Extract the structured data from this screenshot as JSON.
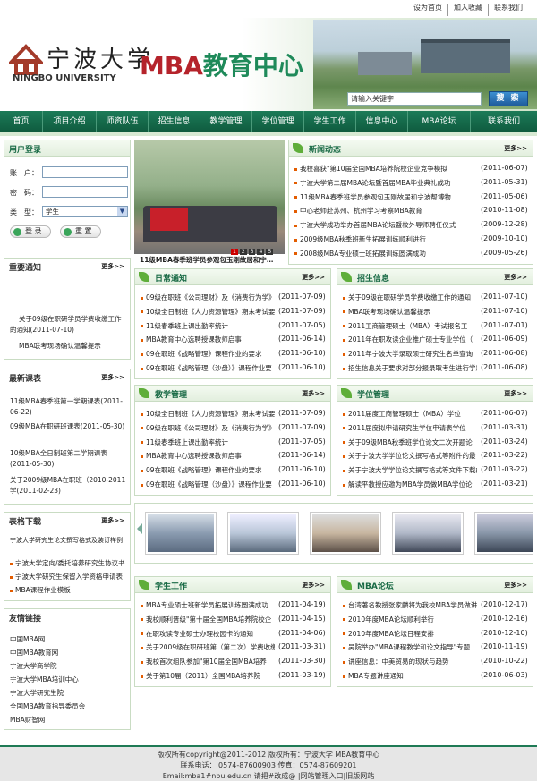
{
  "top_links": [
    "设为首页",
    "加入收藏",
    "联系我们"
  ],
  "header": {
    "school_cn": "宁波大学",
    "school_en": "NINGBO UNIVERSITY",
    "center_prefix": "MBA",
    "center_cn": "教育中心",
    "search_placeholder": "请输入关键字",
    "search_btn": "搜 索"
  },
  "nav": [
    "首页",
    "项目介绍",
    "师资队伍",
    "招生信息",
    "教学管理",
    "学位管理",
    "学生工作",
    "信息中心",
    "MBA论坛",
    "联系我们"
  ],
  "login": {
    "title": "用户登录",
    "account_label": "账　户：",
    "password_label": "密　码：",
    "type_label": "类　型：",
    "type_value": "学生",
    "login_btn": "登 录",
    "reset_btn": "重 置"
  },
  "photo_caption": "11级MBA春季班学员参观包玉刚故居和宁…",
  "photo_pager": [
    "1",
    "2",
    "3",
    "4",
    "5"
  ],
  "more": "更多>>",
  "important": {
    "title": "重要通知",
    "items": [
      "关于09级在职研学员学费收缴工作的通知(2011-07-10)",
      "MBA联考现场确认温馨提示"
    ]
  },
  "courses": {
    "title": "最新课表",
    "items": [
      "11级MBA春季班第一学期课表(2011-06-22)",
      "09级MBA在职研班课表(2011-05-30)",
      "10级MBA全日制班第二学期课表(2011-05-30)",
      "关于2009级MBA在职班（2010-2011学(2011-02-23)"
    ]
  },
  "forms": {
    "title": "表格下载",
    "items": [
      "宁波大学研究生论文撰写格式及装订样例",
      "宁波大学定向/委托培养研究生协议书",
      "宁波大学研究生保留入学资格申请表",
      "MBA课程作业模板"
    ]
  },
  "friends": {
    "title": "友情链接",
    "items": [
      "中国MBA网",
      "中国MBA教育网",
      "宁波大学商学院",
      "宁波大学MBA培训中心",
      "宁波大学研究生院",
      "全国MBA教育指导委员会",
      "MBA财智网"
    ]
  },
  "news": {
    "title": "新闻动态",
    "items": [
      {
        "t": "我校喜获\"第10届全国MBA培养院校企业竞争模拟",
        "d": "(2011-06-07)"
      },
      {
        "t": "宁波大学第二届MBA论坛暨首届MBA毕业典礼成功",
        "d": "(2011-05-31)"
      },
      {
        "t": "11级MBA春季班学员参观包玉刚故居和宁波帮博物",
        "d": "(2011-05-06)"
      },
      {
        "t": "中心老师赴苏州、杭州学习考察MBA教育",
        "d": "(2010-11-08)"
      },
      {
        "t": "宁波大学成功举办首届MBA论坛暨校外导师聘任仪式",
        "d": "(2009-12-28)"
      },
      {
        "t": "2009级MBA秋季班新生拓展训练顺利进行",
        "d": "(2009-10-10)"
      },
      {
        "t": "2008级MBA专业硕士班拓展训练圆满成功",
        "d": "(2009-05-26)"
      }
    ]
  },
  "daily": {
    "title": "日常通知",
    "items": [
      {
        "t": "09级在职班《公司理财》及《消费行为学》",
        "d": "(2011-07-09)"
      },
      {
        "t": "10级全日制班《人力资源管理》期末考试要",
        "d": "(2011-07-09)"
      },
      {
        "t": "11级春季班上课出勤率统计",
        "d": "(2011-07-05)"
      },
      {
        "t": "MBA教育中心选聘授课教师启事",
        "d": "(2011-06-14)"
      },
      {
        "t": "09在职班《战略管理》课程作业的要求",
        "d": "(2011-06-10)"
      },
      {
        "t": "09在职班《战略管理（沙盘）》课程作业要",
        "d": "(2011-06-10)"
      }
    ]
  },
  "enroll": {
    "title": "招生信息",
    "items": [
      {
        "t": "关于09级在职研学员学费收缴工作的通知",
        "d": "(2011-07-10)"
      },
      {
        "t": "MBA联考现场确认温馨提示",
        "d": "(2011-07-10)"
      },
      {
        "t": "2011工商管理硕士（MBA）考试报名工",
        "d": "(2011-07-01)"
      },
      {
        "t": "2011年在职攻读企业推广硕士专业学位（",
        "d": "(2011-06-09)"
      },
      {
        "t": "2011年宁波大学录取硕士研究生名单查询",
        "d": "(2011-06-08)"
      },
      {
        "t": "招生信息关于要求对部分报录取考生进行学籍",
        "d": "(2011-06-08)"
      }
    ]
  },
  "teaching": {
    "title": "教学管理",
    "items": [
      {
        "t": "10级全日制班《人力资源管理》期末考试要",
        "d": "(2011-07-09)"
      },
      {
        "t": "09级在职班《公司理财》及《消费行为学》",
        "d": "(2011-07-09)"
      },
      {
        "t": "11级春季班上课出勤率统计",
        "d": "(2011-07-05)"
      },
      {
        "t": "MBA教育中心选聘授课教师启事",
        "d": "(2011-06-14)"
      },
      {
        "t": "09在职班《战略管理》课程作业的要求",
        "d": "(2011-06-10)"
      },
      {
        "t": "09在职班《战略管理（沙盘）》课程作业要",
        "d": "(2011-06-10)"
      }
    ]
  },
  "degree": {
    "title": "学位管理",
    "items": [
      {
        "t": "2011届度工商管理硕士（MBA）学位",
        "d": "(2011-06-07)"
      },
      {
        "t": "2011届度拟申请研究生学位申请表学位",
        "d": "(2011-03-31)"
      },
      {
        "t": "关于09级MBA秋季班学位论文二次开题论",
        "d": "(2011-03-24)"
      },
      {
        "t": "关于宁波大学学位论文撰写格式等附件的最",
        "d": "(2011-03-22)"
      },
      {
        "t": "关于宁波大学学位论文撰写格式等文件下载的",
        "d": "(2011-03-22)"
      },
      {
        "t": "解读平教授应邀为MBA学员做MBA学位论",
        "d": "(2011-03-21)"
      }
    ]
  },
  "student": {
    "title": "学生工作",
    "items": [
      {
        "t": "MBA专业硕士班新学员拓展训练圆满成功",
        "d": "(2011-04-19)"
      },
      {
        "t": "我校顺利晋级\"第十届全国MBA培养院校企",
        "d": "(2011-04-15)"
      },
      {
        "t": "在职攻读专业硕士办理校园卡的通知",
        "d": "(2011-04-06)"
      },
      {
        "t": "关于2009级在职研班第（第二次）学费收缴",
        "d": "(2011-03-31)"
      },
      {
        "t": "我校首次组队参加\"第10届全国MBA培养",
        "d": "(2011-03-30)"
      },
      {
        "t": "关于第10届（2011）全国MBA培养院",
        "d": "(2011-03-19)"
      }
    ]
  },
  "forum": {
    "title": "MBA论坛",
    "items": [
      {
        "t": "台湾著名教授张家麟将为我校MBA学员做讲",
        "d": "(2010-12-17)"
      },
      {
        "t": "2010年度MBA论坛顺利举行",
        "d": "(2010-12-16)"
      },
      {
        "t": "2010年度MBA论坛日程安排",
        "d": "(2010-12-10)"
      },
      {
        "t": "吴院举办\"MBA课程教学和论文指导\"专题",
        "d": "(2010-11-19)"
      },
      {
        "t": "讲座信息：中美贸易的现状与趋势",
        "d": "(2010-10-22)"
      },
      {
        "t": "MBA专题讲座通知",
        "d": "(2010-06-03)"
      }
    ]
  },
  "footer": {
    "line1": "版权所有copyright@2011-2012 版权所有：宁波大学 MBA教育中心",
    "line2": "联系电话： 0574-87600903 传真：0574-87609201",
    "line3": "Email:mba1#nbu.edu.cn 请把#改成@ |网站管理入口|旧版网站"
  },
  "colors": {
    "nav": "#176a4a",
    "brand_red": "#b5232b",
    "brand_green": "#1f8a5a",
    "bullet": "#e35c00"
  }
}
